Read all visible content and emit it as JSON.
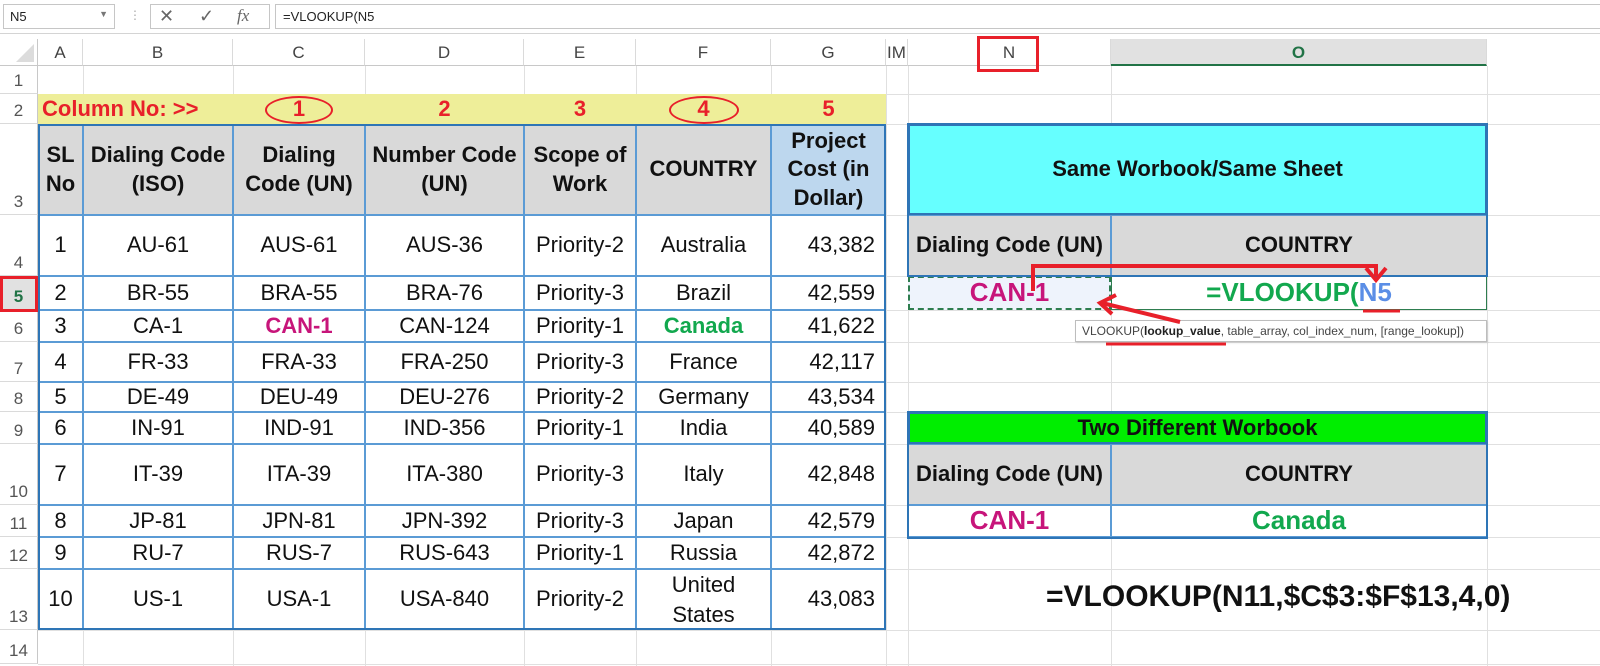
{
  "formula_bar": {
    "name_box": "N5",
    "formula": "=VLOOKUP(N5",
    "cancel_icon": "✕",
    "enter_icon": "✓",
    "fx_label": "fx"
  },
  "columns": [
    "A",
    "B",
    "C",
    "D",
    "E",
    "F",
    "G",
    "IM",
    "N",
    "O"
  ],
  "active_column": "O",
  "rows": [
    "1",
    "2",
    "3",
    "4",
    "5",
    "6",
    "7",
    "8",
    "9",
    "10",
    "11",
    "12",
    "13",
    "14"
  ],
  "active_row": "5",
  "column_numbers": {
    "label": "Column No: >>",
    "values": [
      "1",
      "2",
      "3",
      "4",
      "5"
    ]
  },
  "main_table": {
    "headers": [
      "SL No",
      "Dialing Code (ISO)",
      "Dialing Code (UN)",
      "Number Code (UN)",
      "Scope of Work",
      "COUNTRY",
      "Project Cost (in Dollar)"
    ],
    "rows": [
      [
        "1",
        "AU-61",
        "AUS-61",
        "AUS-36",
        "Priority-2",
        "Australia",
        "43,382"
      ],
      [
        "2",
        "BR-55",
        "BRA-55",
        "BRA-76",
        "Priority-3",
        "Brazil",
        "42,559"
      ],
      [
        "3",
        "CA-1",
        "CAN-1",
        "CAN-124",
        "Priority-1",
        "Canada",
        "41,622"
      ],
      [
        "4",
        "FR-33",
        "FRA-33",
        "FRA-250",
        "Priority-3",
        "France",
        "42,117"
      ],
      [
        "5",
        "DE-49",
        "DEU-49",
        "DEU-276",
        "Priority-2",
        "Germany",
        "43,534"
      ],
      [
        "6",
        "IN-91",
        "IND-91",
        "IND-356",
        "Priority-1",
        "India",
        "40,589"
      ],
      [
        "7",
        "IT-39",
        "ITA-39",
        "ITA-380",
        "Priority-3",
        "Italy",
        "42,848"
      ],
      [
        "8",
        "JP-81",
        "JPN-81",
        "JPN-392",
        "Priority-3",
        "Japan",
        "42,579"
      ],
      [
        "9",
        "RU-7",
        "RUS-7",
        "RUS-643",
        "Priority-1",
        "Russia",
        "42,872"
      ],
      [
        "10",
        "US-1",
        "USA-1",
        "USA-840",
        "Priority-2",
        "United States",
        "43,083"
      ]
    ]
  },
  "same_sheet": {
    "title": "Same Worbook/Same Sheet",
    "col1_header": "Dialing Code (UN)",
    "col2_header": "COUNTRY",
    "lookup_value": "CAN-1",
    "formula_prefix": "=VLOOKUP(",
    "formula_ref": "N5"
  },
  "tooltip": {
    "prefix": "VLOOKUP(",
    "bold_arg": "lookup_value",
    "rest": ", table_array, col_index_num, [range_lookup])"
  },
  "two_workbook": {
    "title": "Two Different Worbook",
    "col1_header": "Dialing Code (UN)",
    "col2_header": "COUNTRY",
    "lookup_value": "CAN-1",
    "result": "Canada"
  },
  "bottom_formula": "=VLOOKUP(N11,$C$3:$F$13,4,0)",
  "colors": {
    "highlight_magenta": "#c7157a",
    "highlight_green": "#12a84e",
    "annotation_red": "#e8202a",
    "cyan_fill": "#66ffff",
    "green_fill": "#00ee00",
    "yellow_fill": "#eeee99",
    "header_gray": "#d9d9d9",
    "cost_header_blue": "#bdd7ee",
    "ref_blue": "#5b8ee6"
  }
}
